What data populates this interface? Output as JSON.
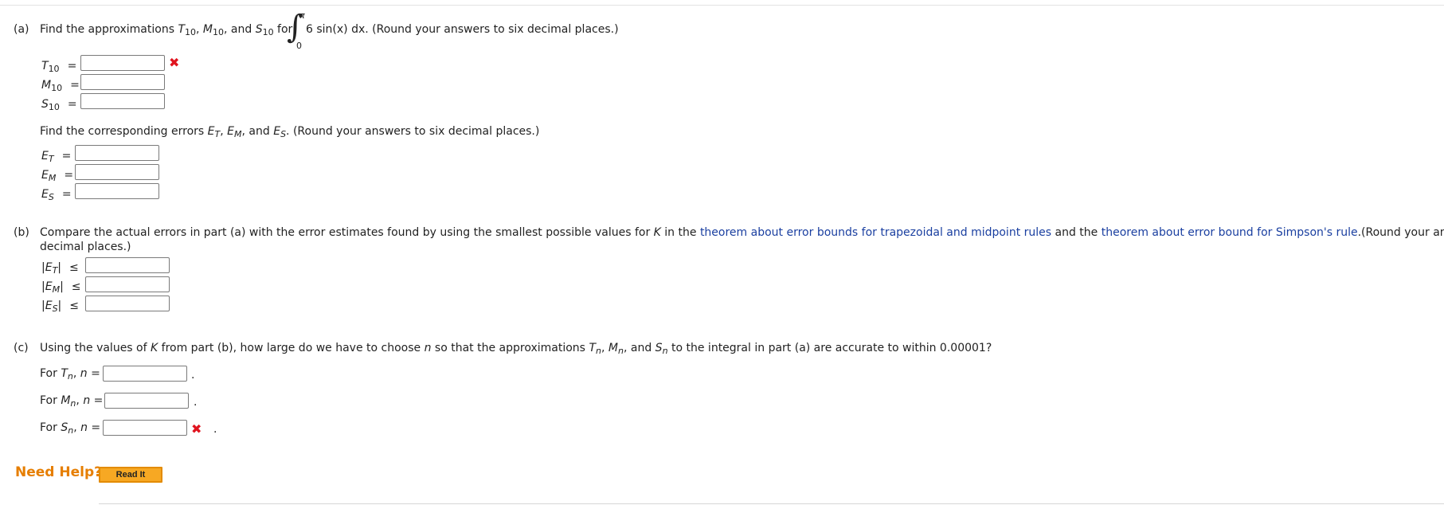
{
  "part_a": {
    "label": "(a)",
    "q_text1": "Find the approximations ",
    "T": "T",
    "M": "M",
    "S": "S",
    "sub10": "10",
    "sep1": ", ",
    "sep2": ", and ",
    "for_text": " for ",
    "integrand": "6 sin(x) dx. (Round your answers to six decimal places.)",
    "int_upper": "π",
    "int_lower": "0",
    "rows": [
      {
        "symbol": "T",
        "sub": "10",
        "eq": "=",
        "value": "",
        "status": "incorrect"
      },
      {
        "symbol": "M",
        "sub": "10",
        "eq": "=",
        "value": "",
        "status": ""
      },
      {
        "symbol": "S",
        "sub": "10",
        "eq": "=",
        "value": "",
        "status": ""
      }
    ],
    "errors_text1": "Find the corresponding errors ",
    "E": "E",
    "subT": "T",
    "subM": "M",
    "subS": "S",
    "errors_text2": ". (Round your answers to six decimal places.)",
    "error_rows": [
      {
        "symbol": "E",
        "sub": "T",
        "eq": "=",
        "value": ""
      },
      {
        "symbol": "E",
        "sub": "M",
        "eq": "=",
        "value": ""
      },
      {
        "symbol": "E",
        "sub": "S",
        "eq": "=",
        "value": ""
      }
    ]
  },
  "part_b": {
    "label": "(b)",
    "text1": "Compare the actual errors in part (a) with the error estimates found by using the smallest possible values for ",
    "K": "K",
    "text2": " in the ",
    "link1": "theorem about error bounds for trapezoidal and midpoint rules",
    "text3": " and the ",
    "link2": "theorem about error bound for Simpson's rule",
    "text4": ".(Round your answers to six",
    "text5": "decimal places.)",
    "rows": [
      {
        "bar_open": "|E",
        "sub": "T",
        "bar_close": "|",
        "le": "≤",
        "value": ""
      },
      {
        "bar_open": "|E",
        "sub": "M",
        "bar_close": "|",
        "le": "≤",
        "value": ""
      },
      {
        "bar_open": "|E",
        "sub": "S",
        "bar_close": "|",
        "le": "≤",
        "value": ""
      }
    ]
  },
  "part_c": {
    "label": "(c)",
    "text1": "Using the values of ",
    "K": "K",
    "text2": " from part (b), how large do we have to choose ",
    "n": "n",
    "text3": " so that the approximations ",
    "text4": " to the integral in part (a) are accurate to within 0.00001?",
    "T": "T",
    "M": "M",
    "S": "S",
    "sub_n": "n",
    "rows": [
      {
        "prefix": "For ",
        "symbol": "T",
        "sub": "n",
        "comma": ", ",
        "n": "n",
        "eq": " =",
        "value": "",
        "period": ".",
        "status": ""
      },
      {
        "prefix": "For ",
        "symbol": "M",
        "sub": "n",
        "comma": ", ",
        "n": "n",
        "eq": " =",
        "value": "",
        "period": ".",
        "status": ""
      },
      {
        "prefix": "For ",
        "symbol": "S",
        "sub": "n",
        "comma": ", ",
        "n": "n",
        "eq": " =",
        "value": "",
        "period": ".",
        "status": "incorrect"
      }
    ]
  },
  "help": {
    "label": "Need Help?",
    "read_it": "Read It"
  },
  "icons": {
    "incorrect": "x-mark-icon"
  },
  "colors": {
    "incorrect": "#e0141f",
    "link": "#1a3fa0",
    "help": "#e67e00",
    "button": "#f7a823"
  }
}
